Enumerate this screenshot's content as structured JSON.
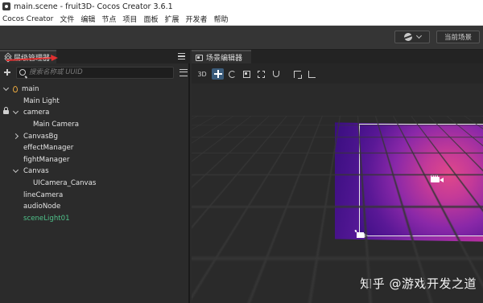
{
  "window": {
    "title": "main.scene - fruit3D- Cocos Creator 3.6.1"
  },
  "menubar": {
    "items": [
      "Cocos Creator",
      "文件",
      "编辑",
      "节点",
      "项目",
      "面板",
      "扩展",
      "开发者",
      "帮助"
    ]
  },
  "toolbar": {
    "scene_button": "当前场景"
  },
  "hierarchy": {
    "tab_label": "层级管理器",
    "search_placeholder": "搜索名称或 UUID",
    "nodes": [
      {
        "label": "main",
        "indent": 0,
        "expand": "down",
        "icon": "flame-icon",
        "color": "#e4e4e4"
      },
      {
        "label": "Main Light",
        "indent": 1,
        "expand": "",
        "icon": "",
        "color": "#e4e4e4"
      },
      {
        "label": "camera",
        "indent": 1,
        "expand": "down",
        "icon": "lock-icon",
        "color": "#e4e4e4"
      },
      {
        "label": "Main Camera",
        "indent": 2,
        "expand": "",
        "icon": "",
        "color": "#e4e4e4"
      },
      {
        "label": "CanvasBg",
        "indent": 1,
        "expand": "right",
        "icon": "",
        "color": "#e4e4e4"
      },
      {
        "label": "effectManager",
        "indent": 1,
        "expand": "",
        "icon": "",
        "color": "#e4e4e4"
      },
      {
        "label": "fightManager",
        "indent": 1,
        "expand": "",
        "icon": "",
        "color": "#e4e4e4"
      },
      {
        "label": "Canvas",
        "indent": 1,
        "expand": "down",
        "icon": "",
        "color": "#e4e4e4"
      },
      {
        "label": "UICamera_Canvas",
        "indent": 2,
        "expand": "",
        "icon": "",
        "color": "#e4e4e4"
      },
      {
        "label": "lineCamera",
        "indent": 1,
        "expand": "",
        "icon": "",
        "color": "#e4e4e4"
      },
      {
        "label": "audioNode",
        "indent": 1,
        "expand": "",
        "icon": "",
        "color": "#e4e4e4"
      },
      {
        "label": "sceneLight01",
        "indent": 1,
        "expand": "",
        "icon": "",
        "color": "#4fc28a"
      }
    ]
  },
  "scene_editor": {
    "tab_label": "场景编辑器",
    "mode_3d": "3D",
    "tools": [
      "move-icon",
      "rotate-icon",
      "scale-icon",
      "rect-icon",
      "snap-icon",
      "pivot-icon",
      "local-icon"
    ],
    "active_tool": "move-icon"
  },
  "watermark": "知乎 @游戏开发之道",
  "colors": {
    "annotation_arrow": "#e03030",
    "active_tool_bg": "#3a5b7a",
    "selected_node_text": "#4fc28a"
  }
}
